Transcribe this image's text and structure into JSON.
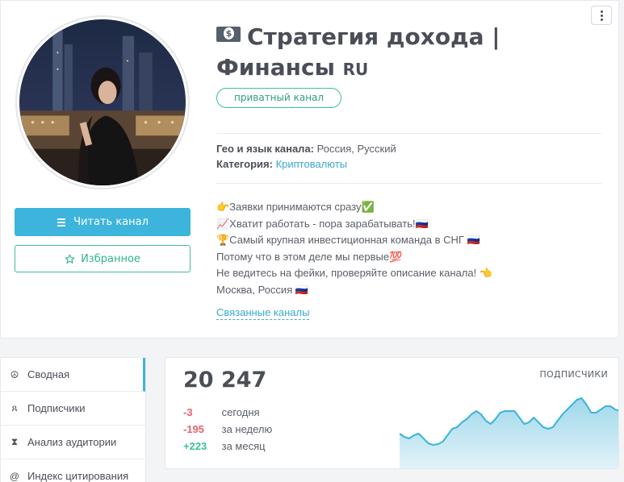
{
  "channel": {
    "title_line1": "Стратегия дохода |",
    "title_line2": "Финансы",
    "title_flag": "RU",
    "badge": "приватный канал",
    "geo_label": "Гео и язык канала:",
    "geo_value": "Россия, Русский",
    "category_label": "Категория:",
    "category_value": "Криптовалюты",
    "description": [
      "👉Заявки принимаются сразу✅",
      "📈Хватит работать - пора зарабатывать!🇷🇺",
      "🏆Самый крупная инвестиционная команда в СНГ 🇷🇺",
      "Потому что в этом деле мы первые💯",
      "Не ведитесь на фейки, проверяйте описание канала! 👈",
      "Москва, Россия 🇷🇺"
    ],
    "related_link": "Связанные каналы"
  },
  "actions": {
    "read_label": "Читать канал",
    "favorite_label": "Избранное"
  },
  "icons": {
    "more": "more-vertical-icon",
    "read": "feed-icon",
    "favorite": "star-icon",
    "title": "money-icon"
  },
  "sidebar": {
    "items": [
      {
        "label": "Сводная",
        "icon": "dashboard-icon",
        "active": true
      },
      {
        "label": "Подписчики",
        "icon": "users-icon",
        "active": false
      },
      {
        "label": "Анализ аудитории",
        "icon": "hourglass-icon",
        "active": false
      },
      {
        "label": "Индекс цитирования",
        "icon": "at-icon",
        "active": false
      }
    ]
  },
  "stats": {
    "subscribers": "20 247",
    "label": "ПОДПИСЧИКИ",
    "rows": [
      {
        "value": "-3",
        "label": "сегодня",
        "trend": "neg"
      },
      {
        "value": "-195",
        "label": "за неделю",
        "trend": "neg"
      },
      {
        "value": "+223",
        "label": "за месяц",
        "trend": "pos"
      }
    ],
    "sparkline": [
      64,
      68,
      70,
      66,
      64,
      70,
      76,
      78,
      77,
      74,
      66,
      58,
      56,
      50,
      46,
      40,
      36,
      40,
      48,
      52,
      46,
      38,
      36,
      36,
      36,
      44,
      52,
      50,
      44,
      50,
      56,
      58,
      56,
      48,
      40,
      34,
      28,
      22,
      20,
      28,
      38,
      38,
      34,
      30,
      30,
      34,
      36
    ],
    "accent": "#3db4dc"
  },
  "colors": {
    "primary": "#3db4dc",
    "green": "#3fbf95",
    "red": "#e8636c"
  }
}
